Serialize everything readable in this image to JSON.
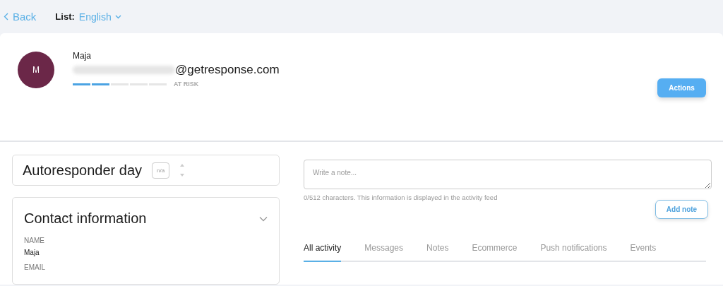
{
  "topbar": {
    "back": "Back",
    "list_label": "List:",
    "list_value": "English"
  },
  "contact": {
    "initial": "M",
    "name": "Maja",
    "email_visible": "@getresponse.com",
    "engagement": {
      "level": 0.4,
      "status": "AT RISK"
    },
    "actions_button": "Actions"
  },
  "autoresponder": {
    "title": "Autoresponder day",
    "day": "n/a"
  },
  "contact_info": {
    "title": "Contact information",
    "expanded": true,
    "fields": [
      {
        "label": "NAME",
        "value": "Maja"
      },
      {
        "label": "EMAIL"
      }
    ]
  },
  "note": {
    "placeholder": "Write a note...",
    "hint": "0/512 characters. This information is displayed in the activity feed",
    "button": "Add note"
  },
  "tabs": [
    {
      "label": "All activity",
      "selected": true
    },
    {
      "label": "Messages",
      "selected": false
    },
    {
      "label": "Notes",
      "selected": false
    },
    {
      "label": "Ecommerce",
      "selected": false
    },
    {
      "label": "Push notifications",
      "selected": false
    },
    {
      "label": "Events",
      "selected": false
    }
  ]
}
